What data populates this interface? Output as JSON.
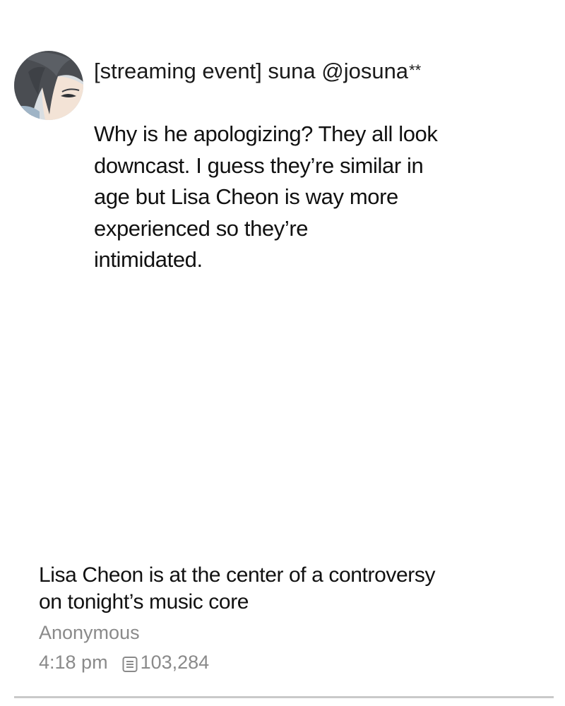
{
  "comment": {
    "header_text": "[streaming event] suna @josuna",
    "handle_mask": "**",
    "body_lines": [
      "Why is he apologizing?  They all look",
      "downcast. I guess they’re  similar in",
      "age but Lisa Cheon is way more",
      "experienced so they’re",
      "intimidated."
    ]
  },
  "post": {
    "title_lines": [
      "Lisa Cheon is at the center of a controversy",
      "on tonight’s music core"
    ],
    "author": "Anonymous",
    "time": "4:18 pm",
    "views": "103,284",
    "views_icon": "list-icon"
  },
  "colors": {
    "text": "#111111",
    "meta": "#8a8a8a",
    "divider": "#c9c9c9"
  }
}
